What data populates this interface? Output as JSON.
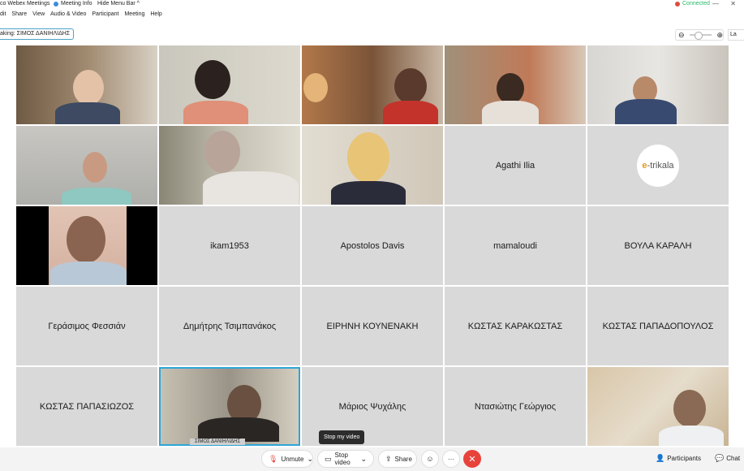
{
  "titlebar": {
    "app_title": "co Webex Meetings",
    "meeting_info": "Meeting Info",
    "hide_menu": "Hide Menu Bar ^",
    "connected": "Connected",
    "window_controls": "— ✕"
  },
  "menu": [
    "dit",
    "Share",
    "View",
    "Audio & Video",
    "Participant",
    "Meeting",
    "Help"
  ],
  "speaking": "aking:  ΣΙΜΟΣ ΔΑΝΙΗΛΙΔΗΣ",
  "layout_label": "La",
  "tiles": [
    {
      "type": "video",
      "name": ""
    },
    {
      "type": "video",
      "name": ""
    },
    {
      "type": "video",
      "name": ""
    },
    {
      "type": "video",
      "name": ""
    },
    {
      "type": "video",
      "name": ""
    },
    {
      "type": "video",
      "name": ""
    },
    {
      "type": "video",
      "name": ""
    },
    {
      "type": "video",
      "name": ""
    },
    {
      "type": "name",
      "name": "Agathi Ilia"
    },
    {
      "type": "logo",
      "name": ""
    },
    {
      "type": "video",
      "name": ""
    },
    {
      "type": "name",
      "name": "ikam1953"
    },
    {
      "type": "name",
      "name": "Apostolos Davis"
    },
    {
      "type": "name",
      "name": "mamaloudi"
    },
    {
      "type": "name",
      "name": "ΒΟΥΛΑ ΚΑΡΑΛΗ"
    },
    {
      "type": "name",
      "name": "Γεράσιμος Φεσσιάν"
    },
    {
      "type": "name",
      "name": "Δημήτρης Τσιμπανάκος"
    },
    {
      "type": "name",
      "name": "ΕΙΡΗΝΗ ΚΟΥΝΕΝΑΚΗ"
    },
    {
      "type": "name",
      "name": "ΚΩΣΤΑΣ ΚΑΡΑΚΩΣΤΑΣ"
    },
    {
      "type": "name",
      "name": "ΚΩΣΤΑΣ ΠΑΠΑΔΟΠΟΥΛΟΣ"
    },
    {
      "type": "name",
      "name": "ΚΩΣΤΑΣ ΠΑΠΑΣΙΩΖΟΣ"
    },
    {
      "type": "video",
      "name": "",
      "tag": "ΣΙΜΟΣ ΔΑΝΙΗΛΙΔΗΣ",
      "active": true
    },
    {
      "type": "name",
      "name": "Μάριος Ψυχάλης"
    },
    {
      "type": "name",
      "name": "Ντασιώτης Γεώργιος"
    },
    {
      "type": "video",
      "name": ""
    }
  ],
  "logo": {
    "e": "e",
    "rest": "-trikala"
  },
  "tooltip": "Stop my video",
  "controls": {
    "unmute": "Unmute",
    "stop_video": "Stop video",
    "share": "Share",
    "more": "···",
    "end": "✕",
    "participants": "Participants",
    "chat": "Chat"
  },
  "colors": {
    "accent": "#2ea6d6",
    "end": "#e8433a",
    "tile": "#d9d9d9"
  }
}
